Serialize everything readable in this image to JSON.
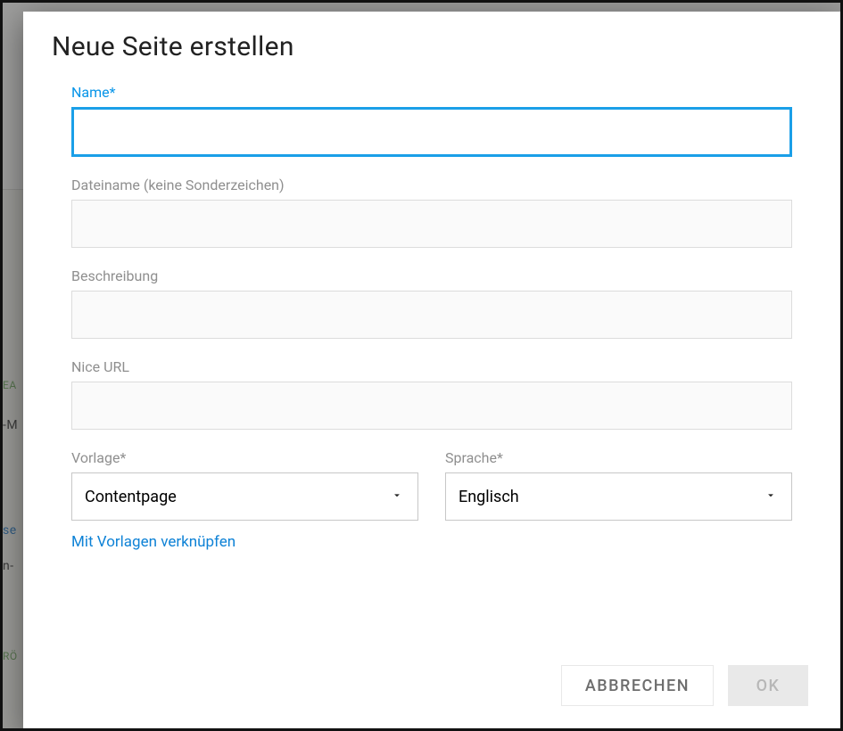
{
  "dialog": {
    "title": "Neue Seite erstellen",
    "fields": {
      "name": {
        "label": "Name*",
        "value": ""
      },
      "filename": {
        "label": "Dateiname (keine Sonderzeichen)",
        "value": ""
      },
      "description": {
        "label": "Beschreibung",
        "value": ""
      },
      "niceurl": {
        "label": "Nice URL",
        "value": ""
      },
      "template": {
        "label": "Vorlage*",
        "value": "Contentpage"
      },
      "language": {
        "label": "Sprache*",
        "value": "Englisch"
      }
    },
    "link_templates": "Mit Vorlagen verknüpfen",
    "buttons": {
      "cancel": "Abbrechen",
      "ok": "OK"
    }
  },
  "background_fragments": {
    "a": "EA",
    "b": "-M",
    "c": "se",
    "d": "n-",
    "e": "RÖ"
  }
}
